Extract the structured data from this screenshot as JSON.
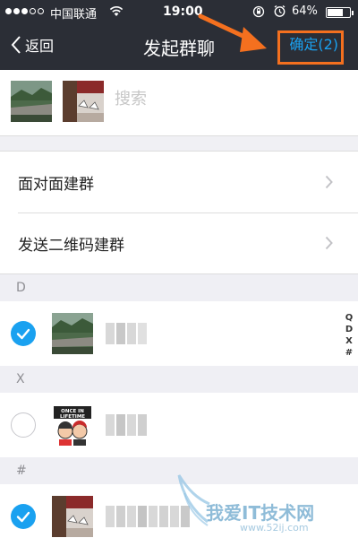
{
  "status_bar": {
    "carrier": "中国联通",
    "time": "19:00",
    "battery": "64%"
  },
  "nav": {
    "back_label": "返回",
    "title": "发起群聊",
    "confirm_label": "确定(2)"
  },
  "search": {
    "placeholder": "搜索"
  },
  "menu": {
    "items": [
      {
        "label": "面对面建群"
      },
      {
        "label": "发送二维码建群"
      }
    ]
  },
  "sections": [
    {
      "letter": "D"
    },
    {
      "letter": "X"
    },
    {
      "letter": "#"
    }
  ],
  "contacts": [
    {
      "section": "D",
      "checked": true,
      "avatar": "landscape-river-photo"
    },
    {
      "section": "X",
      "checked": false,
      "avatar": "once-in-lifetime-cartoon",
      "avatar_text": "ONCE IN LIFETIME"
    },
    {
      "section": "#",
      "checked": true,
      "avatar": "birds-and-flowers-photo"
    }
  ],
  "index_bar": [
    "Q",
    "D",
    "X",
    "#"
  ],
  "watermark": {
    "text": "我爱IT技术网",
    "url": "www.52ij.com"
  },
  "colors": {
    "nav_background": "#2b2e36",
    "accent_blue": "#1aa1f0",
    "highlight_orange": "#f4701f"
  }
}
